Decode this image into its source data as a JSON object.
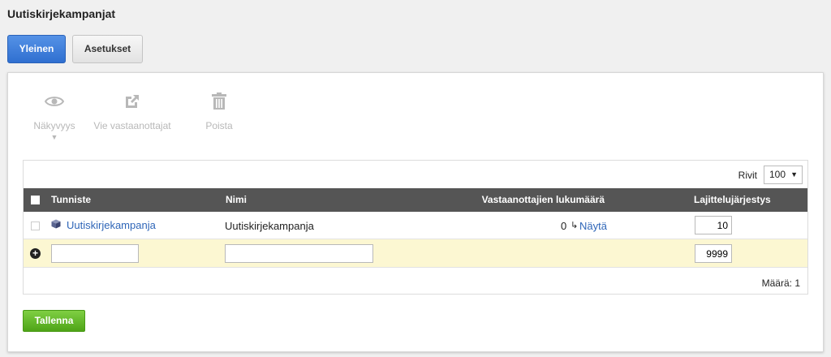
{
  "page": {
    "title": "Uutiskirjekampanjat"
  },
  "tabs": [
    {
      "label": "Yleinen",
      "active": true
    },
    {
      "label": "Asetukset",
      "active": false
    }
  ],
  "toolbar": {
    "visibility": {
      "label": "Näkyvyys",
      "icon": "eye-icon"
    },
    "export": {
      "label": "Vie vastaanottajat",
      "icon": "external-link-icon"
    },
    "delete": {
      "label": "Poista",
      "icon": "trash-icon"
    }
  },
  "grid": {
    "rows_label": "Rivit",
    "rows_value": "100",
    "columns": {
      "id": "Tunniste",
      "name": "Nimi",
      "recipients": "Vastaanottajien lukumäärä",
      "sort": "Lajittelujärjestys"
    },
    "rows": [
      {
        "id": "Uutiskirjekampanja",
        "name": "Uutiskirjekampanja",
        "recipient_count": "0",
        "show_link": "Näytä",
        "sort_order": "10"
      }
    ],
    "new_row": {
      "id": "",
      "name": "",
      "sort_order": "9999"
    },
    "count_text": "Määrä: 1"
  },
  "actions": {
    "save_label": "Tallenna"
  },
  "colors": {
    "primary": "#2f6fd0",
    "header": "#555555",
    "save": "#5cb021",
    "new_row_bg": "#fcf7d2",
    "link": "#2f66b8"
  }
}
